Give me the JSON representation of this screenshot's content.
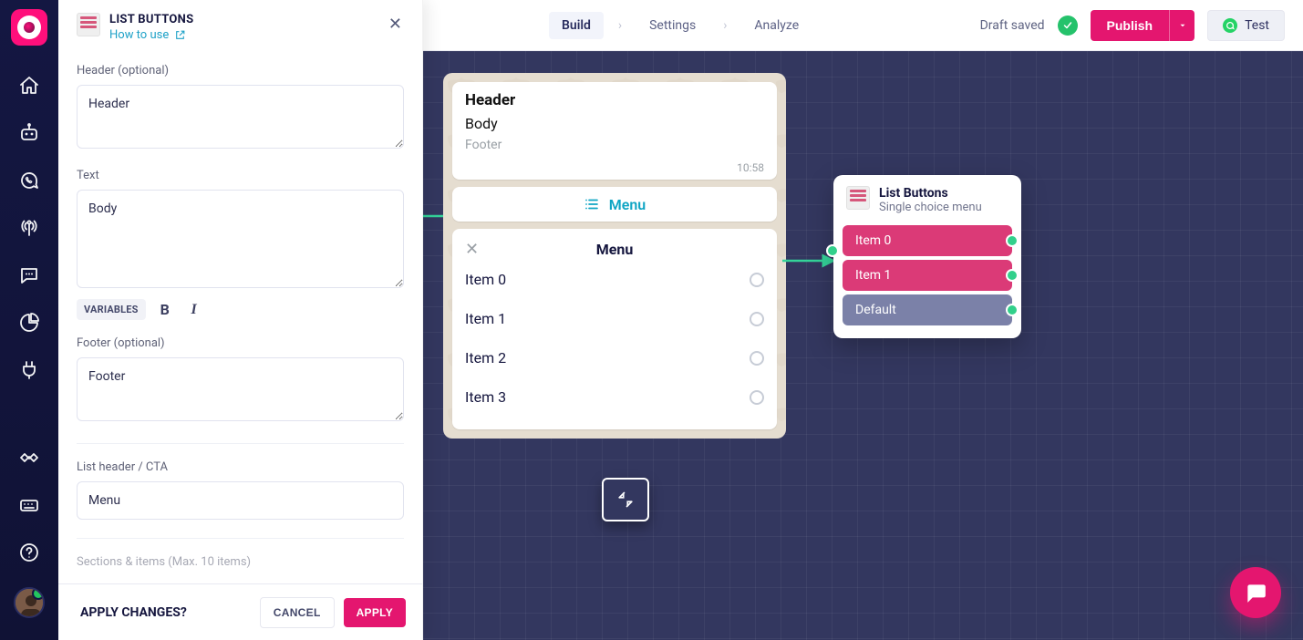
{
  "panel": {
    "title": "LIST BUTTONS",
    "how_to_use": "How to use",
    "labels": {
      "header": "Header (optional)",
      "text": "Text",
      "footer": "Footer (optional)",
      "cta": "List header / CTA",
      "sections": "Sections & items (Max. 10 items)"
    },
    "values": {
      "header": "Header",
      "text": "Body",
      "footer": "Footer",
      "cta": "Menu"
    },
    "toolbar_chip": "VARIABLES",
    "apply_q": "APPLY CHANGES?",
    "cancel": "CANCEL",
    "apply": "APPLY"
  },
  "topbar": {
    "tabs": {
      "build": "Build",
      "settings": "Settings",
      "analyze": "Analyze"
    },
    "saved": "Draft saved",
    "publish": "Publish",
    "test": "Test"
  },
  "preview": {
    "header": "Header",
    "body": "Body",
    "footer": "Footer",
    "time": "10:58",
    "menu_btn": "Menu",
    "sheet_title": "Menu",
    "items": [
      "Item 0",
      "Item 1",
      "Item 2",
      "Item 3"
    ]
  },
  "node": {
    "title": "List Buttons",
    "subtitle": "Single choice menu",
    "items": [
      "Item 0",
      "Item 1",
      "Default"
    ]
  }
}
